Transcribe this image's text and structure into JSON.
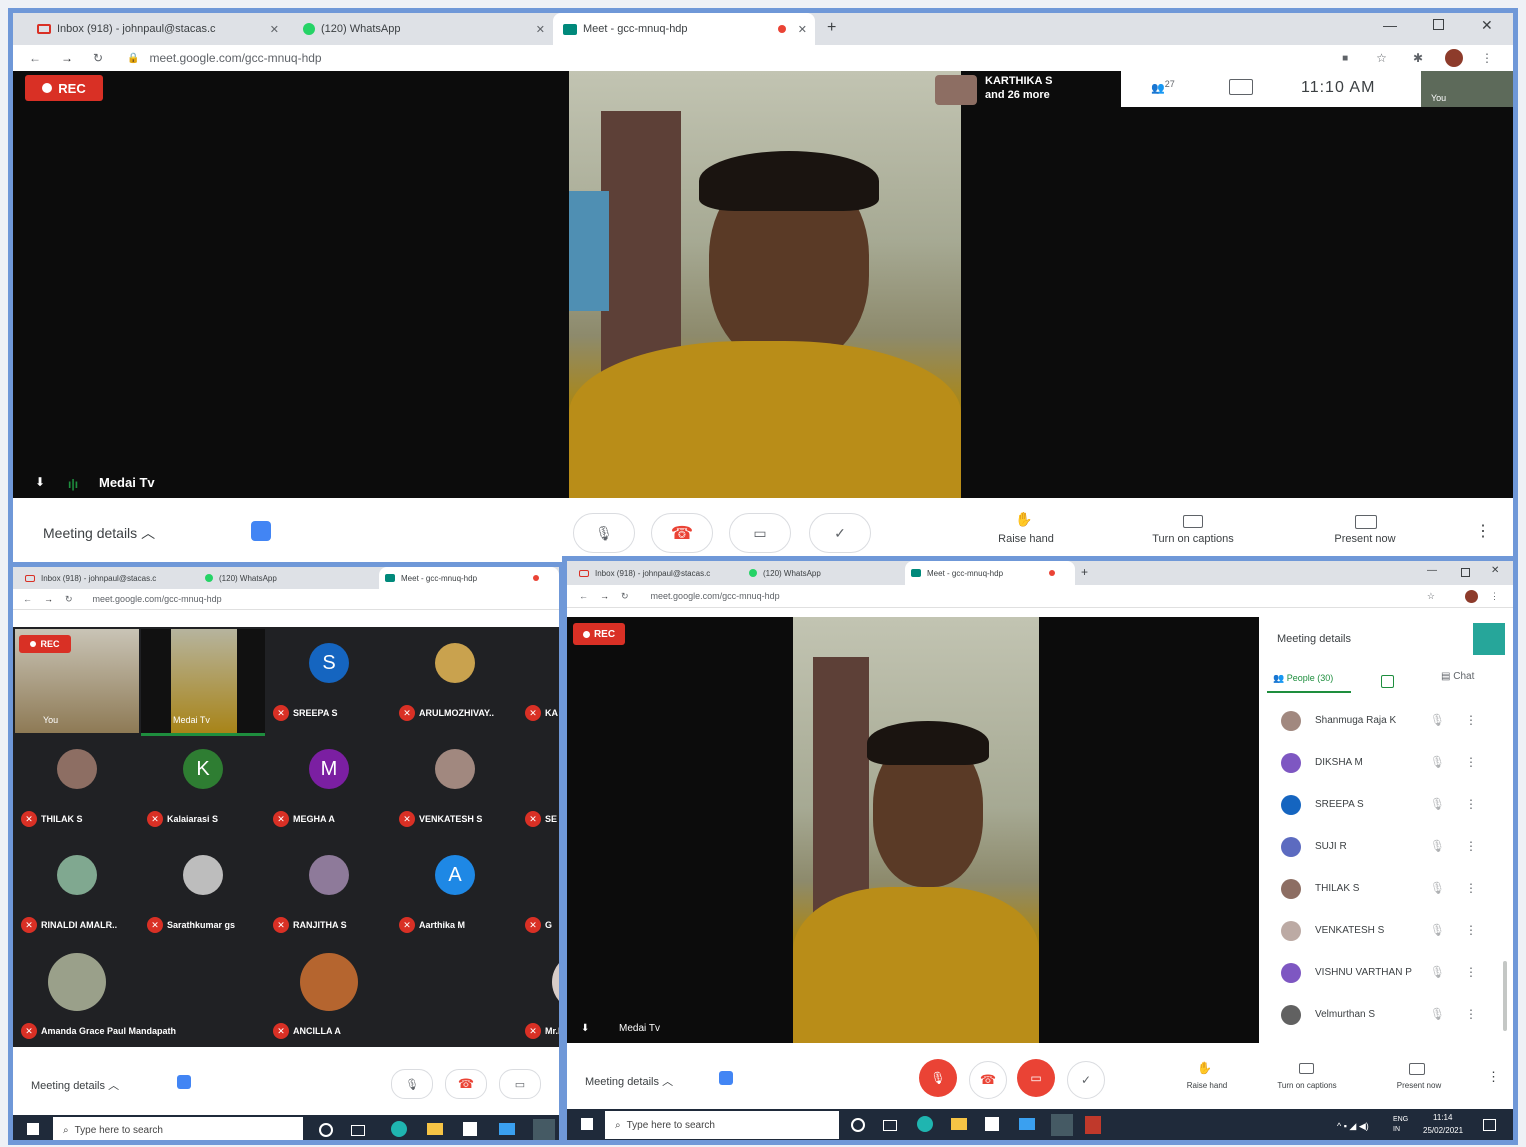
{
  "colors": {
    "frame_border": "#6f98d8",
    "rec_red": "#d93025",
    "meet_dark": "#0c0c0c",
    "taskbar": "#1f2a3a"
  },
  "top_window": {
    "tabs": [
      {
        "label": "Inbox (918) - johnpaul@stacas.c",
        "icon": "gmail-icon"
      },
      {
        "label": "(120) WhatsApp",
        "icon": "whatsapp-icon"
      },
      {
        "label": "Meet - gcc-mnuq-hdp",
        "icon": "meet-icon"
      }
    ],
    "url": "meet.google.com/gcc-mnuq-hdp",
    "rec": "REC",
    "presenter_name": "Medai Tv",
    "others_label": "KARTHIKA S",
    "others_more": "and 26 more",
    "people_count": "27",
    "time": "11:10 AM",
    "self_label": "You",
    "meeting_details": "Meeting details",
    "raise_hand": "Raise hand",
    "captions": "Turn on captions",
    "present": "Present now"
  },
  "left_window": {
    "tabs": [
      {
        "label": "Inbox (918) - johnpaul@stacas.c",
        "icon": "gmail-icon"
      },
      {
        "label": "(120) WhatsApp",
        "icon": "whatsapp-icon"
      },
      {
        "label": "Meet - gcc-mnuq-hdp",
        "icon": "meet-icon"
      }
    ],
    "url": "meet.google.com/gcc-mnuq-hdp",
    "rec": "REC",
    "self_label": "You",
    "presenter_name": "Medai Tv",
    "participants": [
      {
        "name": "SREEPA S",
        "initial": "S",
        "color": "#1565c0"
      },
      {
        "name": "ARULMOZHIVAY..",
        "initial": "",
        "color": "#c9a24e"
      },
      {
        "name": "KA",
        "initial": "",
        "color": "#333333"
      },
      {
        "name": "THILAK S",
        "initial": "",
        "color": "#8d6e63"
      },
      {
        "name": "Kalaiarasi S",
        "initial": "K",
        "color": "#2e7d32"
      },
      {
        "name": "MEGHA A",
        "initial": "M",
        "color": "#7b1fa2"
      },
      {
        "name": "VENKATESH S",
        "initial": "",
        "color": "#a1887f"
      },
      {
        "name": "SE",
        "initial": "",
        "color": "#333333"
      },
      {
        "name": "RINALDI AMALR..",
        "initial": "",
        "color": "#80a890"
      },
      {
        "name": "Sarathkumar gs",
        "initial": "",
        "color": "#bdbdbd"
      },
      {
        "name": "RANJITHA S",
        "initial": "",
        "color": "#8e7a9a"
      },
      {
        "name": "Aarthika M",
        "initial": "A",
        "color": "#1e88e5"
      },
      {
        "name": "G",
        "initial": "",
        "color": "#333333"
      },
      {
        "name": "Amanda Grace Paul Mandapath",
        "initial": "",
        "color": "#9aa08a"
      },
      {
        "name": "ANCILLA A",
        "initial": "",
        "color": "#b5652f"
      },
      {
        "name": "Mr.E.Niranjan Assistant",
        "initial": "",
        "color": "#d7ccc8"
      }
    ],
    "meeting_details": "Meeting details",
    "taskbar_search": "Type here to search"
  },
  "right_window": {
    "tabs": [
      {
        "label": "Inbox (918) - johnpaul@stacas.c",
        "icon": "gmail-icon"
      },
      {
        "label": "(120) WhatsApp",
        "icon": "whatsapp-icon"
      },
      {
        "label": "Meet - gcc-mnuq-hdp",
        "icon": "meet-icon"
      }
    ],
    "url": "meet.google.com/gcc-mnuq-hdp",
    "rec": "REC",
    "presenter_name": "Medai Tv",
    "panel_title": "Meeting details",
    "people_tab": "People (30)",
    "chat_tab": "Chat",
    "people": [
      {
        "name": "Shanmuga Raja K",
        "color": "#a1887f"
      },
      {
        "name": "DIKSHA M",
        "color": "#7e57c2"
      },
      {
        "name": "SREEPA S",
        "color": "#1565c0"
      },
      {
        "name": "SUJI R",
        "color": "#5c6bc0"
      },
      {
        "name": "THILAK S",
        "color": "#8d6e63"
      },
      {
        "name": "VENKATESH S",
        "color": "#bcaaa4"
      },
      {
        "name": "VISHNU VARTHAN P",
        "color": "#7e57c2"
      },
      {
        "name": "Velmurthan S",
        "color": "#616161"
      }
    ],
    "meeting_details": "Meeting details",
    "raise_hand": "Raise hand",
    "captions": "Turn on captions",
    "present": "Present now",
    "taskbar_search": "Type here to search",
    "tray_time": "11:14",
    "tray_date": "25/02/2021",
    "tray_lang": "ENG IN"
  }
}
